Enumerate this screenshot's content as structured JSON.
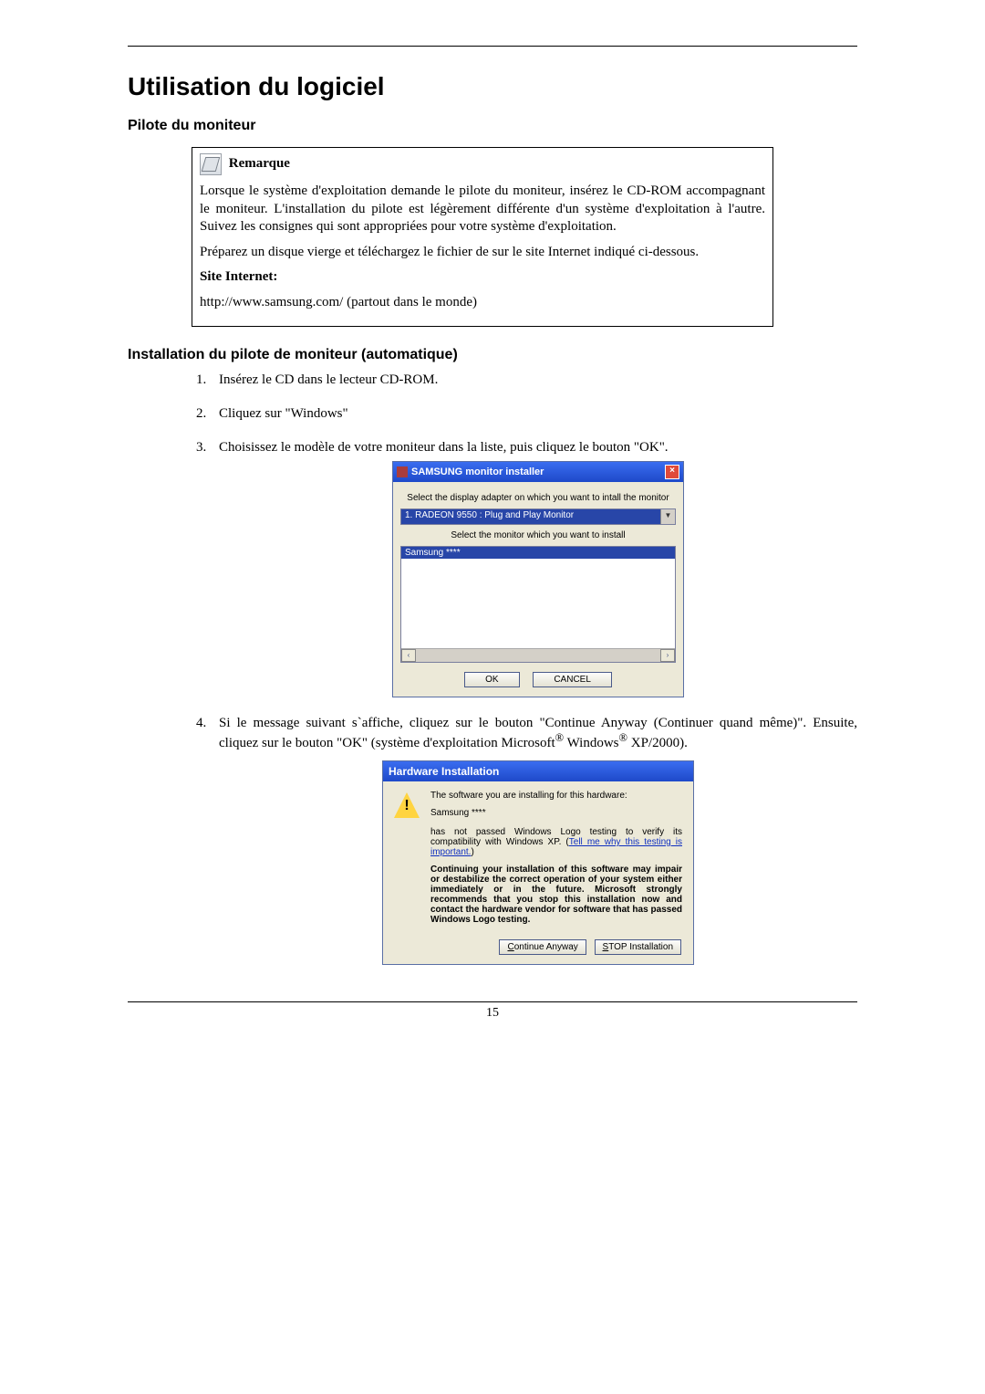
{
  "headings": {
    "main": "Utilisation du logiciel",
    "sub1": "Pilote du moniteur",
    "sub2": "Installation du pilote de moniteur (automatique)"
  },
  "note": {
    "label": "Remarque",
    "p1": "Lorsque le système d'exploitation demande le pilote du moniteur, insérez le CD-ROM accompagnant le moniteur. L'installation du pilote est légèrement différente d'un système d'exploitation à l'autre. Suivez les consignes qui sont appropriées pour votre système d'exploitation.",
    "p2": "Préparez un disque vierge et téléchargez le fichier de sur le site Internet indiqué ci-dessous.",
    "site_label": "Site Internet:",
    "url": "http://www.samsung.com/ (partout dans le monde)"
  },
  "steps": {
    "s1": "Insérez le CD dans le lecteur CD-ROM.",
    "s2": "Cliquez sur \"Windows\"",
    "s3": "Choisissez le modèle de votre moniteur dans la liste, puis cliquez le bouton \"OK\".",
    "s4_prefix": "Si le message suivant s`affiche, cliquez sur le bouton \"Continue Anyway (Continuer quand même)\". Ensuite, cliquez sur le bouton \"OK\" (système d'exploitation Microsoft",
    "s4_mid": " Windows",
    "s4_suffix": " XP/2000)."
  },
  "dialog1": {
    "title": "SAMSUNG monitor installer",
    "close": "×",
    "instr1": "Select the display adapter on which you want to intall the monitor",
    "dropdown": "1. RADEON 9550 : Plug and Play Monitor",
    "arrow": "▼",
    "instr2": "Select the monitor which you want to install",
    "list_item": "Samsung ****",
    "left_arrow": "‹",
    "right_arrow": "›",
    "ok": "OK",
    "cancel": "CANCEL"
  },
  "dialog2": {
    "title": "Hardware Installation",
    "bang": "!",
    "line1": "The software you are installing for this hardware:",
    "hw": "Samsung ****",
    "line2a": "has not passed Windows Logo testing to verify its compatibility with Windows XP. (",
    "link": "Tell me why this testing is important.",
    "line2b": ")",
    "bold": "Continuing your installation of this software may impair or destabilize the correct operation of your system either immediately or in the future. Microsoft strongly recommends that you stop this installation now and contact the hardware vendor for software that has passed Windows Logo testing.",
    "btn_continue_u": "C",
    "btn_continue_rest": "ontinue Anyway",
    "btn_stop_u": "S",
    "btn_stop_rest": "TOP Installation"
  },
  "pagenum": "15",
  "reg": "®"
}
